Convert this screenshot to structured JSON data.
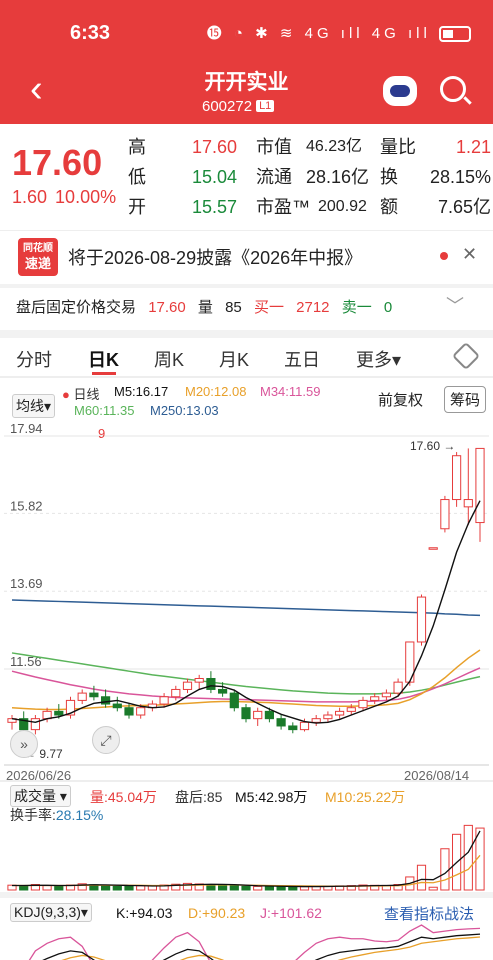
{
  "status": {
    "time": "6:33",
    "icons": "⓯ ◔ ✱ ≋ 4G ıll 4G ıll"
  },
  "header": {
    "title": "开开实业",
    "code": "600272",
    "badge": "L1"
  },
  "quote": {
    "price": "17.60",
    "change": "1.60",
    "change_pct": "10.00%",
    "rows": [
      {
        "k1": "高",
        "v1": "17.60",
        "k2": "市值",
        "v2": "46.23亿",
        "k3": "量比",
        "v3": "1.21"
      },
      {
        "k1": "低",
        "v1": "15.04",
        "k2": "流通",
        "v2": "28.16亿",
        "k3": "换",
        "v3": "28.15%"
      },
      {
        "k1": "开",
        "v1": "15.57",
        "k2": "市盈™",
        "v2": "200.92",
        "k3": "额",
        "v3": "7.65亿"
      }
    ]
  },
  "notice": {
    "logo_top": "同花顺",
    "logo_bottom": "速递",
    "text": "将于2026-08-29披露《2026年中报》",
    "close": "✕"
  },
  "after_hours": {
    "label": "盘后固定价格交易",
    "price": "17.60",
    "vol_label": "量",
    "vol": "85",
    "buy_label": "买一",
    "buy": "2712",
    "sell_label": "卖一",
    "sell": "0"
  },
  "tabs": [
    "分时",
    "日K",
    "周K",
    "月K",
    "五日",
    "更多▾"
  ],
  "chart_header": {
    "ma_selector": "均线▾",
    "series_label": "日线",
    "ma5": "M5:16.17",
    "ma20": "M20:12.08",
    "ma34": "M34:11.59",
    "ma60": "M60:11.35",
    "ma250": "M250:13.03",
    "adjust": "前复权",
    "chips": "筹码"
  },
  "volume_header": {
    "selector": "成交量 ▾",
    "vol": "量:45.04万",
    "after": "盘后:85",
    "m5": "M5:42.98万",
    "m10": "M10:25.22万",
    "turnover": "换手率:",
    "turnover_val": "28.15%"
  },
  "kdj_header": {
    "selector": "KDJ(9,3,3)▾",
    "k": "K:+94.03",
    "d": "D:+90.23",
    "j": "J:+101.62",
    "link": "查看指标战法"
  },
  "colors": {
    "up": "#e63c3c",
    "down": "#1a7a2a",
    "ma5": "#111111",
    "ma20": "#e8a02a",
    "ma34": "#d9559a",
    "ma60": "#5ab45a",
    "ma250": "#2e5d93"
  },
  "chart_data": {
    "type": "candlestick",
    "y_ticks": [
      "17.94",
      "15.82",
      "13.69",
      "11.56"
    ],
    "x_start": "2026/06/26",
    "x_end": "2026/08/14",
    "max_label": "17.60",
    "min_label": "9.77",
    "marker": "9",
    "candles": [
      [
        10.1,
        10.3,
        9.9,
        10.2
      ],
      [
        10.2,
        10.4,
        9.8,
        9.9
      ],
      [
        9.9,
        10.3,
        9.77,
        10.2
      ],
      [
        10.2,
        10.5,
        10.1,
        10.4
      ],
      [
        10.4,
        10.6,
        10.2,
        10.3
      ],
      [
        10.3,
        10.8,
        10.2,
        10.7
      ],
      [
        10.7,
        11.0,
        10.6,
        10.9
      ],
      [
        10.9,
        11.1,
        10.7,
        10.8
      ],
      [
        10.8,
        11.0,
        10.5,
        10.6
      ],
      [
        10.6,
        10.8,
        10.4,
        10.5
      ],
      [
        10.5,
        10.6,
        10.2,
        10.3
      ],
      [
        10.3,
        10.6,
        10.2,
        10.5
      ],
      [
        10.5,
        10.7,
        10.4,
        10.6
      ],
      [
        10.6,
        10.9,
        10.5,
        10.8
      ],
      [
        10.8,
        11.1,
        10.7,
        11.0
      ],
      [
        11.0,
        11.3,
        10.9,
        11.2
      ],
      [
        11.2,
        11.4,
        11.0,
        11.3
      ],
      [
        11.3,
        11.5,
        10.9,
        11.0
      ],
      [
        11.0,
        11.2,
        10.8,
        10.9
      ],
      [
        10.9,
        11.0,
        10.4,
        10.5
      ],
      [
        10.5,
        10.6,
        10.1,
        10.2
      ],
      [
        10.2,
        10.5,
        10.0,
        10.4
      ],
      [
        10.4,
        10.5,
        10.1,
        10.2
      ],
      [
        10.2,
        10.3,
        9.9,
        10.0
      ],
      [
        10.0,
        10.1,
        9.8,
        9.9
      ],
      [
        9.9,
        10.2,
        9.85,
        10.1
      ],
      [
        10.1,
        10.3,
        10.0,
        10.2
      ],
      [
        10.2,
        10.4,
        10.1,
        10.3
      ],
      [
        10.3,
        10.5,
        10.2,
        10.4
      ],
      [
        10.4,
        10.6,
        10.3,
        10.5
      ],
      [
        10.5,
        10.8,
        10.4,
        10.7
      ],
      [
        10.7,
        10.9,
        10.6,
        10.8
      ],
      [
        10.8,
        11.0,
        10.7,
        10.9
      ],
      [
        10.9,
        11.3,
        10.8,
        11.2
      ],
      [
        11.2,
        12.3,
        11.1,
        12.3
      ],
      [
        12.3,
        13.6,
        12.2,
        13.53
      ],
      [
        14.88,
        14.88,
        14.88,
        14.88
      ],
      [
        15.4,
        16.3,
        15.3,
        16.2
      ],
      [
        16.2,
        17.5,
        16.0,
        17.4
      ],
      [
        16.0,
        17.6,
        15.5,
        16.2
      ],
      [
        15.57,
        17.6,
        15.04,
        17.6
      ]
    ],
    "ma5": [
      10.2,
      10.15,
      10.1,
      10.2,
      10.25,
      10.35,
      10.5,
      10.62,
      10.66,
      10.7,
      10.62,
      10.54,
      10.5,
      10.52,
      10.62,
      10.82,
      11.0,
      11.1,
      11.08,
      10.98,
      10.78,
      10.62,
      10.46,
      10.32,
      10.22,
      10.12,
      10.08,
      10.1,
      10.18,
      10.3,
      10.42,
      10.54,
      10.66,
      10.82,
      11.22,
      11.92,
      12.74,
      13.73,
      14.76,
      15.54,
      16.17
    ],
    "ma20": [
      10.5,
      10.48,
      10.46,
      10.45,
      10.45,
      10.46,
      10.48,
      10.5,
      10.52,
      10.54,
      10.55,
      10.56,
      10.57,
      10.58,
      10.6,
      10.62,
      10.64,
      10.66,
      10.67,
      10.67,
      10.66,
      10.65,
      10.64,
      10.62,
      10.6,
      10.58,
      10.56,
      10.55,
      10.54,
      10.54,
      10.55,
      10.56,
      10.58,
      10.62,
      10.72,
      10.88,
      11.08,
      11.32,
      11.6,
      11.86,
      12.08
    ],
    "ma34": [
      11.5,
      11.42,
      11.34,
      11.27,
      11.2,
      11.13,
      11.07,
      11.01,
      10.96,
      10.92,
      10.88,
      10.85,
      10.82,
      10.8,
      10.78,
      10.77,
      10.76,
      10.75,
      10.74,
      10.73,
      10.72,
      10.71,
      10.7,
      10.69,
      10.68,
      10.67,
      10.66,
      10.66,
      10.66,
      10.66,
      10.67,
      10.68,
      10.7,
      10.73,
      10.8,
      10.9,
      11.02,
      11.15,
      11.3,
      11.45,
      11.59
    ],
    "ma60": [
      12.0,
      11.95,
      11.9,
      11.85,
      11.8,
      11.75,
      11.7,
      11.65,
      11.6,
      11.55,
      11.5,
      11.45,
      11.4,
      11.36,
      11.32,
      11.28,
      11.24,
      11.2,
      11.16,
      11.12,
      11.08,
      11.05,
      11.02,
      10.99,
      10.96,
      10.94,
      10.92,
      10.9,
      10.89,
      10.88,
      10.88,
      10.88,
      10.89,
      10.9,
      10.93,
      10.98,
      11.04,
      11.12,
      11.2,
      11.28,
      11.35
    ],
    "ma250": [
      13.45,
      13.44,
      13.43,
      13.42,
      13.41,
      13.4,
      13.39,
      13.38,
      13.37,
      13.36,
      13.35,
      13.34,
      13.33,
      13.32,
      13.31,
      13.3,
      13.29,
      13.28,
      13.27,
      13.26,
      13.25,
      13.24,
      13.23,
      13.22,
      13.21,
      13.2,
      13.19,
      13.18,
      13.17,
      13.16,
      13.15,
      13.14,
      13.13,
      13.12,
      13.11,
      13.1,
      13.09,
      13.07,
      13.06,
      13.04,
      13.03
    ],
    "volume": [
      3.5,
      3.0,
      4.0,
      3.2,
      2.8,
      3.6,
      4.5,
      3.8,
      3.0,
      2.6,
      2.8,
      3.0,
      3.2,
      3.6,
      4.2,
      4.8,
      4.4,
      3.9,
      3.4,
      3.0,
      2.7,
      2.6,
      2.9,
      2.5,
      2.3,
      2.4,
      2.6,
      2.8,
      3.0,
      3.2,
      3.6,
      3.4,
      3.3,
      4.0,
      9.5,
      18.0,
      2.0,
      30.0,
      40.5,
      47.0,
      45.04
    ],
    "vol_m5": [
      3.3,
      3.3,
      3.4,
      3.4,
      3.3,
      3.3,
      3.6,
      3.8,
      3.7,
      3.5,
      3.3,
      3.2,
      2.9,
      3.0,
      3.4,
      3.7,
      4.0,
      4.2,
      4.1,
      3.9,
      3.5,
      3.1,
      2.9,
      2.7,
      2.6,
      2.5,
      2.5,
      2.6,
      2.7,
      2.8,
      3.0,
      3.2,
      3.3,
      3.5,
      4.8,
      7.7,
      7.5,
      12.0,
      20.0,
      27.5,
      42.98
    ],
    "vol_m10": [
      3.3,
      3.3,
      3.3,
      3.3,
      3.3,
      3.3,
      3.4,
      3.5,
      3.5,
      3.5,
      3.4,
      3.4,
      3.3,
      3.3,
      3.4,
      3.5,
      3.6,
      3.7,
      3.8,
      3.7,
      3.5,
      3.4,
      3.3,
      3.2,
      3.1,
      3.0,
      2.9,
      2.8,
      2.8,
      2.7,
      2.8,
      2.9,
      3.0,
      3.1,
      3.8,
      5.5,
      5.3,
      7.3,
      11.0,
      15.0,
      25.22
    ],
    "kdj_k": [
      40,
      45,
      55,
      62,
      68,
      72,
      70,
      60,
      50,
      42,
      38,
      44,
      52,
      60,
      68,
      74,
      72,
      62,
      50,
      40,
      32,
      28,
      30,
      36,
      44,
      52,
      60,
      66,
      70,
      72,
      74,
      75,
      76,
      78,
      84,
      90,
      88,
      90,
      92,
      93,
      94.03
    ],
    "kdj_d": [
      45,
      44,
      47,
      52,
      58,
      63,
      66,
      64,
      59,
      53,
      48,
      47,
      48,
      52,
      57,
      63,
      66,
      65,
      60,
      53,
      46,
      40,
      37,
      36,
      38,
      43,
      49,
      55,
      60,
      64,
      67,
      70,
      72,
      74,
      77,
      82,
      84,
      86,
      88,
      89,
      90.23
    ],
    "kdj_j": [
      30,
      48,
      72,
      82,
      88,
      90,
      78,
      52,
      32,
      20,
      18,
      38,
      60,
      76,
      90,
      96,
      84,
      56,
      30,
      14,
      4,
      4,
      16,
      36,
      56,
      70,
      82,
      88,
      90,
      88,
      88,
      85,
      84,
      86,
      98,
      106,
      96,
      98,
      100,
      101,
      101.62
    ]
  }
}
